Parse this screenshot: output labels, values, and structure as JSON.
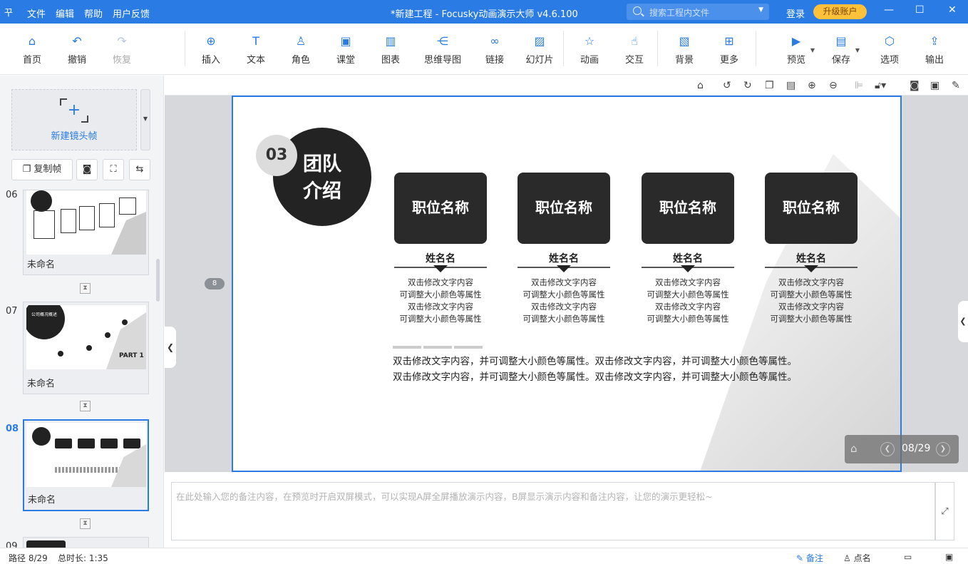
{
  "titlebar": {
    "logo": "꾸",
    "menu": [
      "文件",
      "编辑",
      "帮助",
      "用户反馈"
    ],
    "title": "*新建工程 - Focusky动画演示大师  v4.6.100",
    "search_placeholder": "搜索工程内文件",
    "login": "登录",
    "upgrade": "升级账户"
  },
  "toolbar": {
    "items": [
      {
        "label": "首页",
        "icon": "home-icon"
      },
      {
        "label": "撤销",
        "icon": "undo-icon"
      },
      {
        "label": "恢复",
        "icon": "redo-icon",
        "disabled": true
      },
      {
        "label": "插入",
        "icon": "plus-circle-icon"
      },
      {
        "label": "文本",
        "icon": "text-icon"
      },
      {
        "label": "角色",
        "icon": "person-icon"
      },
      {
        "label": "课堂",
        "icon": "classroom-icon"
      },
      {
        "label": "图表",
        "icon": "chart-icon"
      },
      {
        "label": "思维导图",
        "icon": "mindmap-icon"
      },
      {
        "label": "链接",
        "icon": "link-icon"
      },
      {
        "label": "幻灯片",
        "icon": "slides-icon"
      },
      {
        "label": "动画",
        "icon": "star-icon"
      },
      {
        "label": "交互",
        "icon": "hand-icon"
      },
      {
        "label": "背景",
        "icon": "background-icon"
      },
      {
        "label": "更多",
        "icon": "more-icon"
      },
      {
        "label": "预览",
        "icon": "preview-icon"
      },
      {
        "label": "保存",
        "icon": "save-icon"
      },
      {
        "label": "选项",
        "icon": "settings-icon"
      },
      {
        "label": "输出",
        "icon": "export-icon"
      }
    ]
  },
  "leftpanel": {
    "new_frame": "新建镜头帧",
    "copy_frame": "复制帧",
    "frames": [
      {
        "num": "06",
        "name": "未命名"
      },
      {
        "num": "07",
        "name": "未命名"
      },
      {
        "num": "08",
        "name": "未命名"
      },
      {
        "num": "09",
        "name": ""
      }
    ]
  },
  "slide": {
    "num": "03",
    "title_line1": "团队",
    "title_line2": "介绍",
    "page_badge": "8",
    "cards": [
      {
        "title": "职位名称",
        "name": "姓名名",
        "desc": [
          "双击修改文字内容",
          "可调整大小颜色等属性",
          "双击修改文字内容",
          "可调整大小颜色等属性"
        ]
      },
      {
        "title": "职位名称",
        "name": "姓名名",
        "desc": [
          "双击修改文字内容",
          "可调整大小颜色等属性",
          "双击修改文字内容",
          "可调整大小颜色等属性"
        ]
      },
      {
        "title": "职位名称",
        "name": "姓名名",
        "desc": [
          "双击修改文字内容",
          "可调整大小颜色等属性",
          "双击修改文字内容",
          "可调整大小颜色等属性"
        ]
      },
      {
        "title": "职位名称",
        "name": "姓名名",
        "desc": [
          "双击修改文字内容",
          "可调整大小颜色等属性",
          "双击修改文字内容",
          "可调整大小颜色等属性"
        ]
      }
    ],
    "para1": "双击修改文字内容，并可调整大小颜色等属性。双击修改文字内容，并可调整大小颜色等属性。",
    "para2": "双击修改文字内容，并可调整大小颜色等属性。双击修改文字内容，并可调整大小颜色等属性。"
  },
  "thumb07": {
    "title": "公司概况概述",
    "part": "PART 1"
  },
  "nav": {
    "page": "08/29"
  },
  "notes": {
    "placeholder": "在此处输入您的备注内容，在预览时开启双屏模式，可以实现A屏全屏播放演示内容，B屏显示演示内容和备注内容，让您的演示更轻松~"
  },
  "status": {
    "path": "路径 8/29",
    "duration": "总时长: 1:35",
    "notes": "备注",
    "rollcall": "点名"
  },
  "colors": {
    "accent": "#2a7be4",
    "upgrade": "#ffc13a",
    "dark": "#232323"
  }
}
